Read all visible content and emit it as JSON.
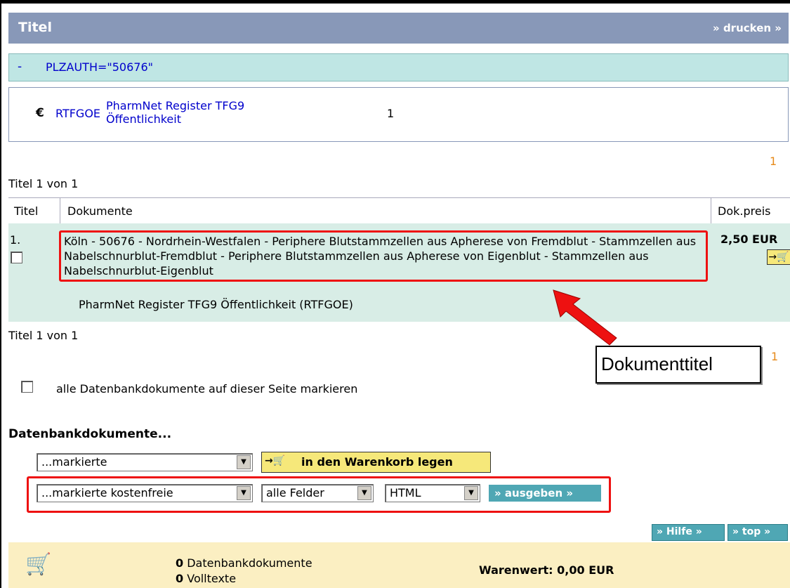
{
  "header": {
    "title": "Titel",
    "print_label": "» drucken »"
  },
  "query": {
    "toggle": "-",
    "text": "PLZAUTH=\"50676\""
  },
  "database": {
    "currency": "€",
    "code": "RTFGOE",
    "name_line1": "PharmNet Register TFG9",
    "name_line2": "Öffentlichkeit",
    "count": "1"
  },
  "pagination": {
    "page": "1",
    "summary": "Titel 1 von 1"
  },
  "table": {
    "headers": [
      "Titel",
      "Dokumente",
      "Dok.preis"
    ],
    "rows": [
      {
        "number": "1.",
        "title": "Köln - 50676 - Nordrhein-Westfalen - Periphere Blutstammzellen aus Apherese von Fremdblut - Stammzellen aus Nabelschnurblut-Fremdblut - Periphere Blutstammzellen aus Apherese von Eigenblut - Stammzellen aus Nabelschnurblut-Eigenblut",
        "source": "PharmNet Register TFG9 Öffentlichkeit (RTFGOE)",
        "price": "2,50 EUR"
      }
    ]
  },
  "annotation": {
    "callout": "Dokumenttitel"
  },
  "mark_all_label": "alle Datenbankdokumente auf dieser Seite markieren",
  "actions": {
    "section_title": "Datenbankdokumente...",
    "select_marked": "...markierte",
    "cart_button": "in den Warenkorb legen",
    "select_free": "...markierte kostenfreie",
    "select_fields": "alle Felder",
    "select_format": "HTML",
    "output_button": "» ausgeben »"
  },
  "nav": {
    "help": "» Hilfe »",
    "top": "» top »"
  },
  "footer": {
    "db_count": "0",
    "db_label": "Datenbankdokumente",
    "full_count": "0",
    "full_label": "Volltexte",
    "worth": "Warenwert: 0,00 EUR"
  },
  "colors": {
    "header_bg": "#8898b8",
    "query_bg": "#bfe6e4",
    "row_bg": "#d8ede6",
    "highlight": "#ee1111",
    "button_teal": "#4fa7b4",
    "cart_yellow": "#f6e87a"
  }
}
